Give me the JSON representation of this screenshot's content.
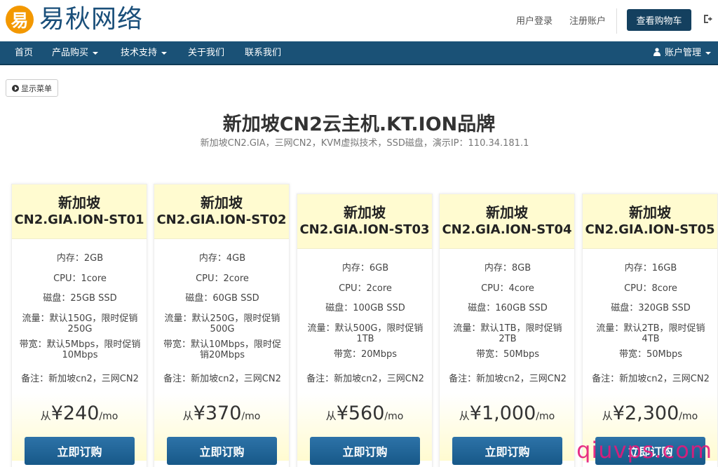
{
  "header": {
    "logo_char": "易",
    "logo_text": "易秋网络",
    "login": "用户登录",
    "register": "注册账户",
    "cart": "查看购物车"
  },
  "nav": {
    "home": "首页",
    "products": "产品购买",
    "support": "技术支持",
    "about": "关于我们",
    "contact": "联系我们",
    "account": "账户管理"
  },
  "show_menu": "显示菜单",
  "page": {
    "title": "新加坡CN2云主机.KT.ION品牌",
    "subtitle": "新加坡CN2.GIA，三网CN2，KVM虚拟技术，SSD磁盘，演示IP：110.34.181.1"
  },
  "products": [
    {
      "name": "新加坡",
      "code": "CN2.GIA.ION-ST01",
      "specs": [
        "内存：2GB",
        "CPU：1core",
        "磁盘：25GB SSD",
        "流量：默认150G，限时促销250G",
        "带宽：默认5Mbps，限时促销10Mbps",
        "备注：新加坡cn2，三网CN2"
      ],
      "price_from": "从",
      "price": "¥240",
      "unit": "/mo",
      "order": "立即订购"
    },
    {
      "name": "新加坡",
      "code": "CN2.GIA.ION-ST02",
      "specs": [
        "内存：4GB",
        "CPU：2core",
        "磁盘：60GB SSD",
        "流量：默认250G，限时促销500G",
        "带宽：默认10Mbps，限时促销20Mbps",
        "备注：新加坡cn2，三网CN2"
      ],
      "price_from": "从",
      "price": "¥370",
      "unit": "/mo",
      "order": "立即订购"
    },
    {
      "name": "新加坡",
      "code": "CN2.GIA.ION-ST03",
      "specs": [
        "内存：6GB",
        "CPU：2core",
        "磁盘：100GB SSD",
        "流量：默认500G，限时促销1TB",
        "带宽：20Mbps",
        "备注：新加坡cn2，三网CN2"
      ],
      "price_from": "从",
      "price": "¥560",
      "unit": "/mo",
      "order": "立即订购"
    },
    {
      "name": "新加坡",
      "code": "CN2.GIA.ION-ST04",
      "specs": [
        "内存：8GB",
        "CPU：4core",
        "磁盘：160GB SSD",
        "流量：默认1TB，限时促销2TB",
        "带宽：50Mbps",
        "备注：新加坡cn2，三网CN2"
      ],
      "price_from": "从",
      "price": "¥1,000",
      "unit": "/mo",
      "order": "立即订购"
    },
    {
      "name": "新加坡",
      "code": "CN2.GIA.ION-ST05",
      "specs": [
        "内存：16GB",
        "CPU：8core",
        "磁盘：320GB SSD",
        "流量：默认2TB，限时促销4TB",
        "带宽：50Mbps",
        "备注：新加坡cn2，三网CN2"
      ],
      "price_from": "从",
      "price": "¥2,300",
      "unit": "/mo",
      "order": "立即订购"
    }
  ],
  "watermark": "qiuvps.com"
}
